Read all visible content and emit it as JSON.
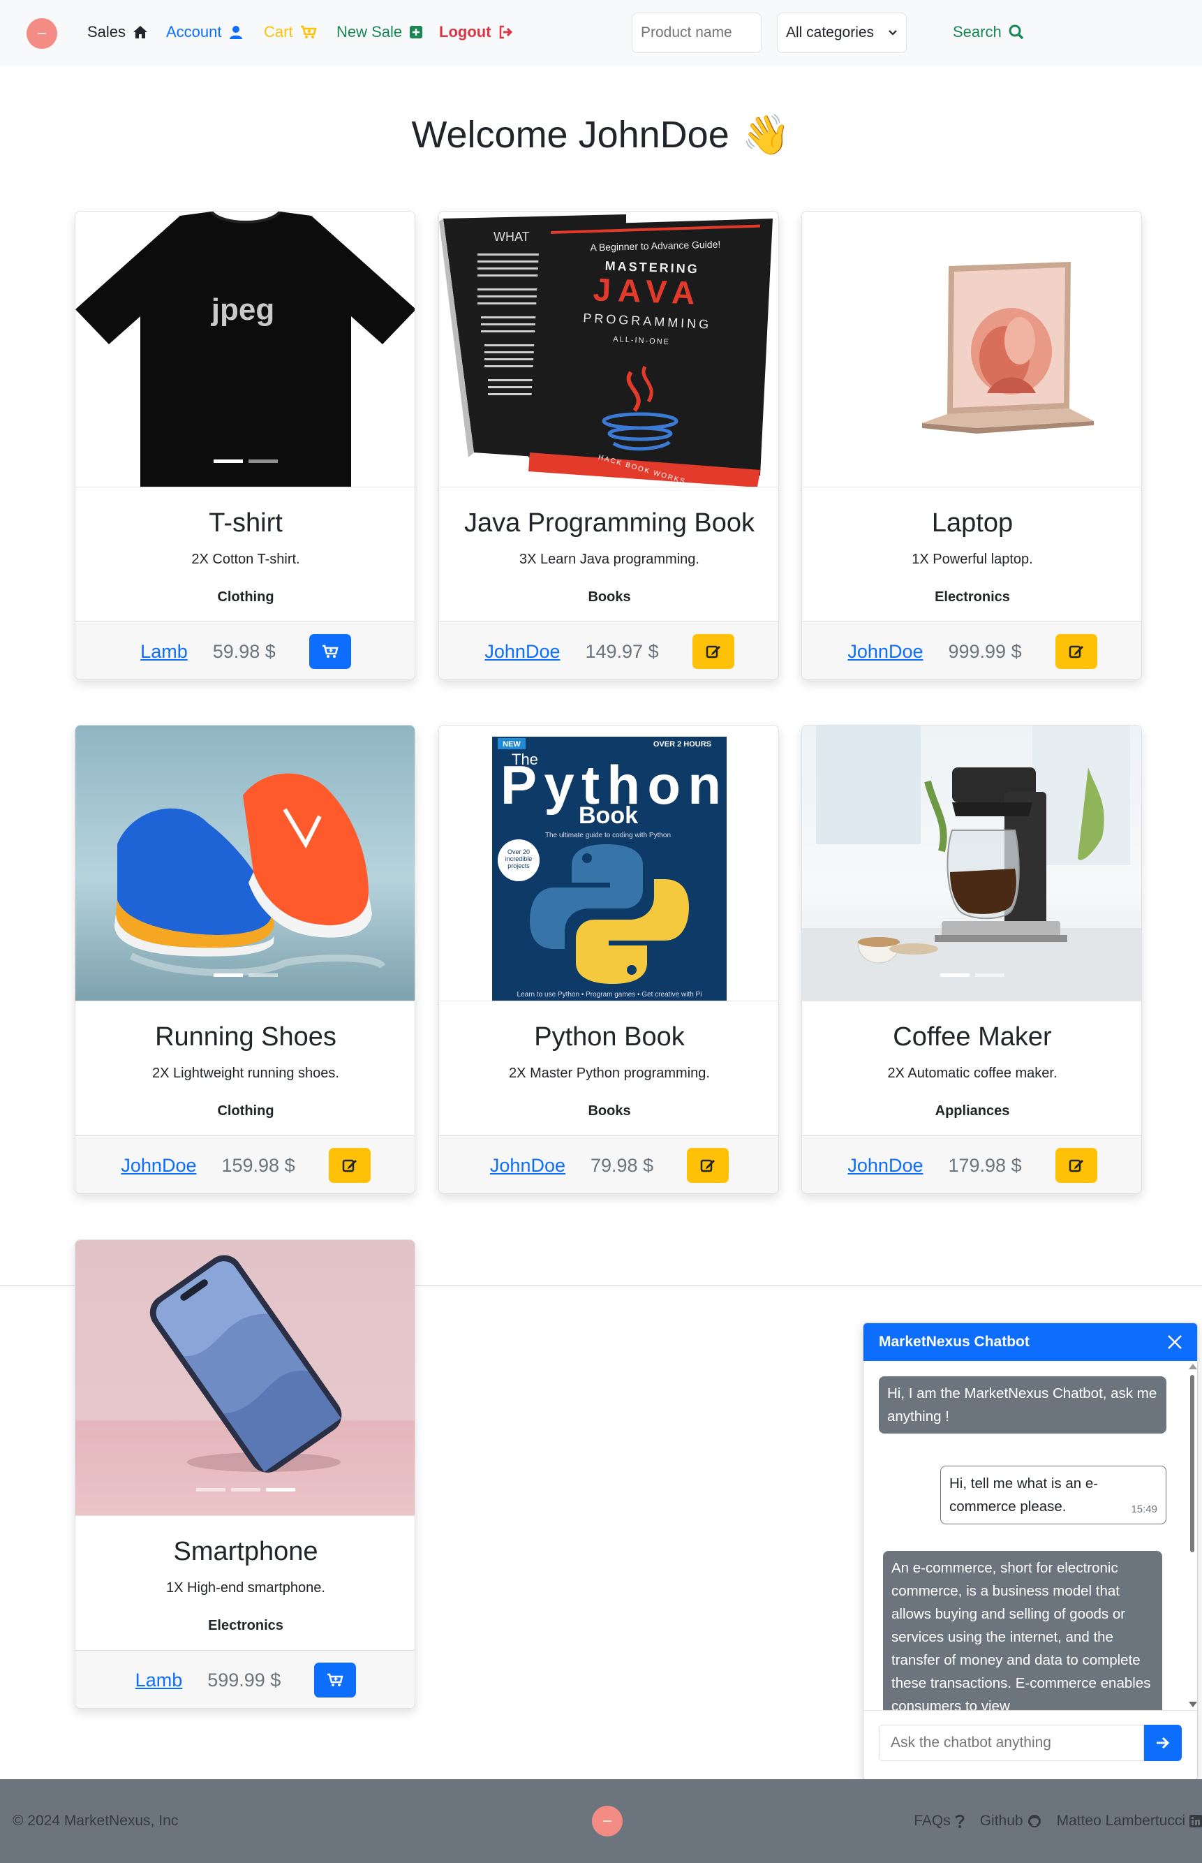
{
  "navbar": {
    "sales_label": "Sales",
    "account_label": "Account",
    "cart_label": "Cart",
    "new_sale_label": "New Sale",
    "logout_label": "Logout",
    "search_placeholder": "Product name",
    "category_selected": "All categories",
    "search_label": "Search"
  },
  "welcome": {
    "text": "Welcome JohnDoe",
    "emoji": "👋"
  },
  "products": [
    {
      "title": "T-shirt",
      "desc": "2X Cotton T-shirt.",
      "category": "Clothing",
      "seller": "Lamb",
      "price": "59.98 $",
      "action": "add-to-cart"
    },
    {
      "title": "Java Programming Book",
      "desc": "3X Learn Java programming.",
      "category": "Books",
      "seller": "JohnDoe",
      "price": "149.97 $",
      "action": "edit"
    },
    {
      "title": "Laptop",
      "desc": "1X Powerful laptop.",
      "category": "Electronics",
      "seller": "JohnDoe",
      "price": "999.99 $",
      "action": "edit"
    },
    {
      "title": "Running Shoes",
      "desc": "2X Lightweight running shoes.",
      "category": "Clothing",
      "seller": "JohnDoe",
      "price": "159.98 $",
      "action": "edit"
    },
    {
      "title": "Python Book",
      "desc": "2X Master Python programming.",
      "category": "Books",
      "seller": "JohnDoe",
      "price": "79.98 $",
      "action": "edit"
    },
    {
      "title": "Coffee Maker",
      "desc": "2X Automatic coffee maker.",
      "category": "Appliances",
      "seller": "JohnDoe",
      "price": "179.98 $",
      "action": "edit"
    },
    {
      "title": "Smartphone",
      "desc": "1X High-end smartphone.",
      "category": "Electronics",
      "seller": "Lamb",
      "price": "599.99 $",
      "action": "add-to-cart"
    }
  ],
  "image_text": {
    "tshirt": "jpeg",
    "java_cover_top": "A Beginner to Advance Guide!",
    "java_cover_mastering": "MASTERING",
    "java_cover_java": "JAVA",
    "java_cover_programming": "PROGRAMMING",
    "java_cover_allinone": "ALL-IN-ONE",
    "java_cover_publisher": "HACK BOOK WORKS",
    "java_back": "WHAT",
    "python_new": "NEW",
    "python_hours": "OVER 2 HOURS",
    "python_the": "The",
    "python_title": "Python",
    "python_book": "Book",
    "python_sub": "The ultimate guide to coding with Python",
    "python_badge": "Over 20 incredible projects",
    "python_bottom": "Learn to use Python • Program games • Get creative with Pi"
  },
  "chatbot": {
    "title": "MarketNexus Chatbot",
    "messages": {
      "bot_greeting": "Hi, I am the MarketNexus Chatbot, ask me anything !",
      "user_question": "Hi, tell me what is an e-commerce please.",
      "user_time": "15:49",
      "bot_answer": "An e-commerce, short for electronic commerce, is a business model that allows buying and selling of goods or services using the internet, and the transfer of money and data to complete these transactions. E-commerce enables consumers to view"
    },
    "input_placeholder": "Ask the chatbot anything"
  },
  "footer": {
    "copyright": "© 2024 MarketNexus, Inc",
    "faqs": "FAQs",
    "github": "Github",
    "author": "Matteo Lambertucci"
  },
  "colors": {
    "primary": "#0d6efd",
    "warning": "#ffc107",
    "success": "#198754",
    "danger": "#dc3545",
    "footer_bg": "#6c757d",
    "logo": "#f38c85"
  },
  "icons": {
    "sales": "home-icon",
    "account": "user-icon",
    "cart": "cart-plus-icon",
    "new_sale": "plus-square-icon",
    "logout": "logout-icon",
    "search": "search-icon",
    "card_cart": "cart-plus-icon",
    "card_edit": "edit-icon",
    "close": "close-icon",
    "send": "arrow-right-icon",
    "faqs": "question-icon",
    "github": "github-icon",
    "linkedin": "linkedin-icon"
  }
}
